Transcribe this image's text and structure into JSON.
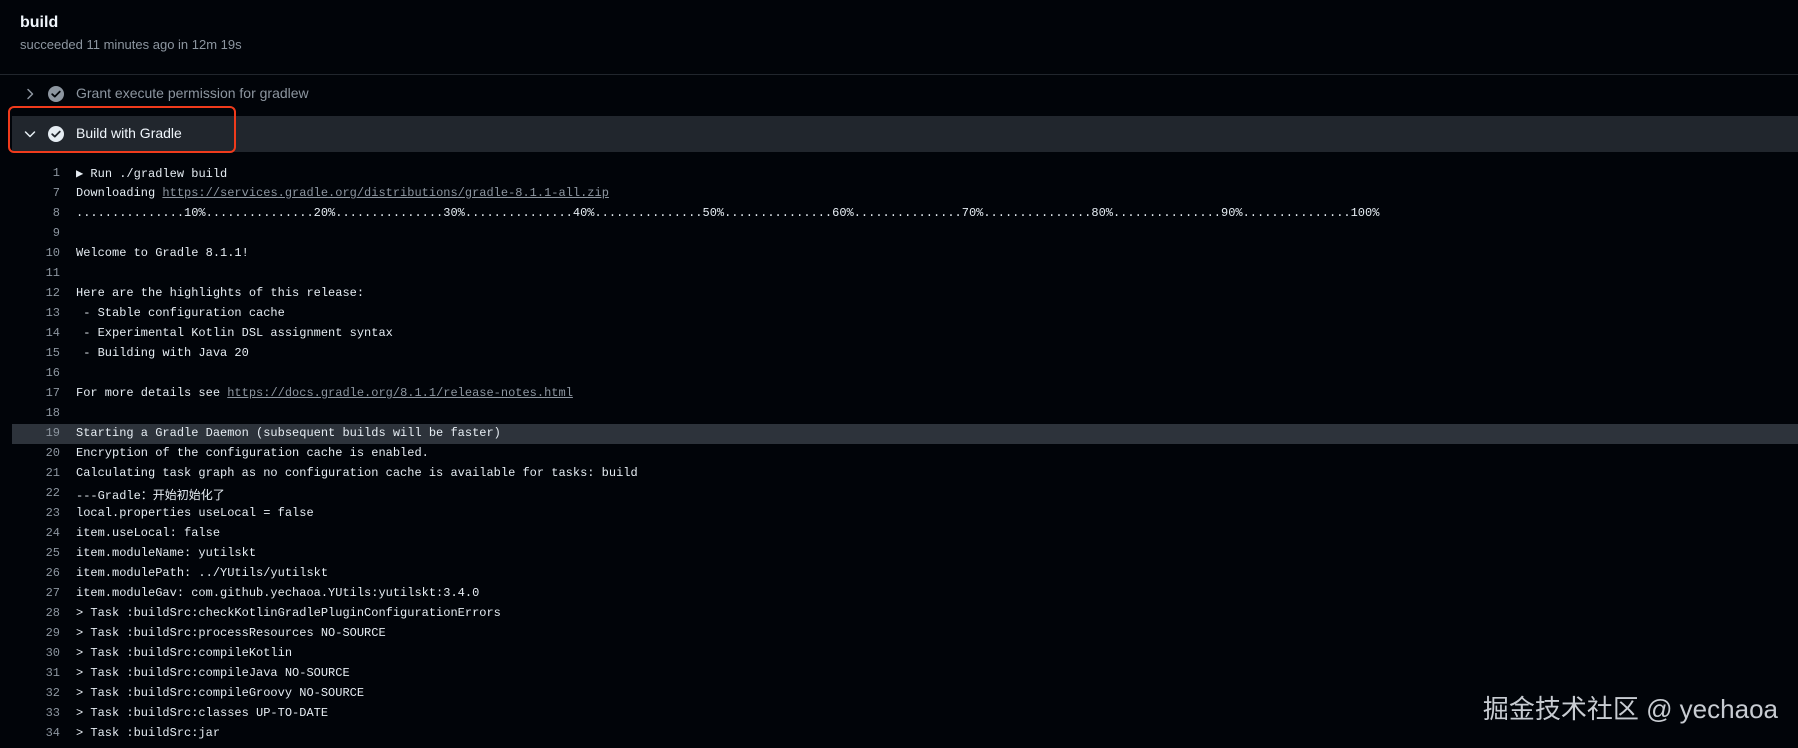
{
  "job": {
    "title": "build",
    "status": "succeeded 11 minutes ago in 12m 19s"
  },
  "steps": [
    {
      "name": "Grant execute permission for gradlew",
      "expanded": false,
      "status_icon": "check-circle-icon"
    },
    {
      "name": "Build with Gradle",
      "expanded": true,
      "status_icon": "check-circle-icon"
    }
  ],
  "colors": {
    "background": "#010409",
    "highlight_box": "#f03b1c",
    "selected_line": "#2d333b",
    "muted_text": "#8d96a0"
  },
  "log": {
    "highlighted_line": "19",
    "lines": [
      {
        "num": "1",
        "pre": "▶ Run ./gradlew build",
        "link": "",
        "post": ""
      },
      {
        "num": "7",
        "pre": "Downloading ",
        "link": "https://services.gradle.org/distributions/gradle-8.1.1-all.zip",
        "post": ""
      },
      {
        "num": "8",
        "pre": "...............10%...............20%...............30%...............40%...............50%...............60%...............70%...............80%...............90%...............100%",
        "link": "",
        "post": ""
      },
      {
        "num": "9",
        "pre": "",
        "link": "",
        "post": ""
      },
      {
        "num": "10",
        "pre": "Welcome to Gradle 8.1.1!",
        "link": "",
        "post": ""
      },
      {
        "num": "11",
        "pre": "",
        "link": "",
        "post": ""
      },
      {
        "num": "12",
        "pre": "Here are the highlights of this release:",
        "link": "",
        "post": ""
      },
      {
        "num": "13",
        "pre": " - Stable configuration cache",
        "link": "",
        "post": ""
      },
      {
        "num": "14",
        "pre": " - Experimental Kotlin DSL assignment syntax",
        "link": "",
        "post": ""
      },
      {
        "num": "15",
        "pre": " - Building with Java 20",
        "link": "",
        "post": ""
      },
      {
        "num": "16",
        "pre": "",
        "link": "",
        "post": ""
      },
      {
        "num": "17",
        "pre": "For more details see ",
        "link": "https://docs.gradle.org/8.1.1/release-notes.html",
        "post": ""
      },
      {
        "num": "18",
        "pre": "",
        "link": "",
        "post": ""
      },
      {
        "num": "19",
        "pre": "Starting a Gradle Daemon (subsequent builds will be faster)",
        "link": "",
        "post": ""
      },
      {
        "num": "20",
        "pre": "Encryption of the configuration cache is enabled.",
        "link": "",
        "post": ""
      },
      {
        "num": "21",
        "pre": "Calculating task graph as no configuration cache is available for tasks: build",
        "link": "",
        "post": ""
      },
      {
        "num": "22",
        "pre": "---Gradle：开始初始化了",
        "link": "",
        "post": ""
      },
      {
        "num": "23",
        "pre": "local.properties useLocal = false",
        "link": "",
        "post": ""
      },
      {
        "num": "24",
        "pre": "item.useLocal: false",
        "link": "",
        "post": ""
      },
      {
        "num": "25",
        "pre": "item.moduleName: yutilskt",
        "link": "",
        "post": ""
      },
      {
        "num": "26",
        "pre": "item.modulePath: ../YUtils/yutilskt",
        "link": "",
        "post": ""
      },
      {
        "num": "27",
        "pre": "item.moduleGav: com.github.yechaoa.YUtils:yutilskt:3.4.0",
        "link": "",
        "post": ""
      },
      {
        "num": "28",
        "pre": "> Task :buildSrc:checkKotlinGradlePluginConfigurationErrors",
        "link": "",
        "post": ""
      },
      {
        "num": "29",
        "pre": "> Task :buildSrc:processResources NO-SOURCE",
        "link": "",
        "post": ""
      },
      {
        "num": "30",
        "pre": "> Task :buildSrc:compileKotlin",
        "link": "",
        "post": ""
      },
      {
        "num": "31",
        "pre": "> Task :buildSrc:compileJava NO-SOURCE",
        "link": "",
        "post": ""
      },
      {
        "num": "32",
        "pre": "> Task :buildSrc:compileGroovy NO-SOURCE",
        "link": "",
        "post": ""
      },
      {
        "num": "33",
        "pre": "> Task :buildSrc:classes UP-TO-DATE",
        "link": "",
        "post": ""
      },
      {
        "num": "34",
        "pre": "> Task :buildSrc:jar",
        "link": "",
        "post": ""
      }
    ]
  },
  "watermark": "掘金技术社区 @ yechaoa"
}
